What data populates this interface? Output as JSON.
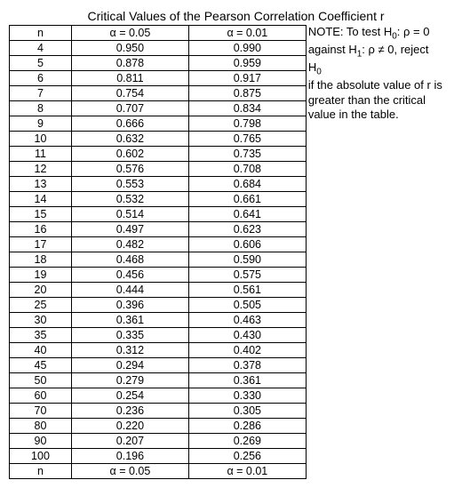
{
  "title": "Critical Values of the Pearson Correlation Coefficient r",
  "headers": {
    "n": "n",
    "a05": "α = 0.05",
    "a01": "α = 0.01"
  },
  "footers": {
    "n": "n",
    "a05": "α = 0.05",
    "a01": "α = 0.01"
  },
  "note": {
    "line1a": "NOTE: To test H",
    "line1sub": "0",
    "line1b": ": ρ = 0",
    "line2a": "against H",
    "line2sub": "1",
    "line2b": ": ρ ≠ 0, reject H",
    "line2sub2": "0",
    "line3": "if the absolute value of r is",
    "line4": "greater than the critical",
    "line5": "value in the table."
  },
  "chart_data": {
    "type": "table",
    "title": "Critical Values of the Pearson Correlation Coefficient r",
    "columns": [
      "n",
      "α = 0.05",
      "α = 0.01"
    ],
    "rows": [
      {
        "n": "4",
        "a05": "0.950",
        "a01": "0.990"
      },
      {
        "n": "5",
        "a05": "0.878",
        "a01": "0.959"
      },
      {
        "n": "6",
        "a05": "0.811",
        "a01": "0.917"
      },
      {
        "n": "7",
        "a05": "0.754",
        "a01": "0.875"
      },
      {
        "n": "8",
        "a05": "0.707",
        "a01": "0.834"
      },
      {
        "n": "9",
        "a05": "0.666",
        "a01": "0.798"
      },
      {
        "n": "10",
        "a05": "0.632",
        "a01": "0.765"
      },
      {
        "n": "11",
        "a05": "0.602",
        "a01": "0.735"
      },
      {
        "n": "12",
        "a05": "0.576",
        "a01": "0.708"
      },
      {
        "n": "13",
        "a05": "0.553",
        "a01": "0.684"
      },
      {
        "n": "14",
        "a05": "0.532",
        "a01": "0.661"
      },
      {
        "n": "15",
        "a05": "0.514",
        "a01": "0.641"
      },
      {
        "n": "16",
        "a05": "0.497",
        "a01": "0.623"
      },
      {
        "n": "17",
        "a05": "0.482",
        "a01": "0.606"
      },
      {
        "n": "18",
        "a05": "0.468",
        "a01": "0.590"
      },
      {
        "n": "19",
        "a05": "0.456",
        "a01": "0.575"
      },
      {
        "n": "20",
        "a05": "0.444",
        "a01": "0.561"
      },
      {
        "n": "25",
        "a05": "0.396",
        "a01": "0.505"
      },
      {
        "n": "30",
        "a05": "0.361",
        "a01": "0.463"
      },
      {
        "n": "35",
        "a05": "0.335",
        "a01": "0.430"
      },
      {
        "n": "40",
        "a05": "0.312",
        "a01": "0.402"
      },
      {
        "n": "45",
        "a05": "0.294",
        "a01": "0.378"
      },
      {
        "n": "50",
        "a05": "0.279",
        "a01": "0.361"
      },
      {
        "n": "60",
        "a05": "0.254",
        "a01": "0.330"
      },
      {
        "n": "70",
        "a05": "0.236",
        "a01": "0.305"
      },
      {
        "n": "80",
        "a05": "0.220",
        "a01": "0.286"
      },
      {
        "n": "90",
        "a05": "0.207",
        "a01": "0.269"
      },
      {
        "n": "100",
        "a05": "0.196",
        "a01": "0.256"
      }
    ]
  }
}
